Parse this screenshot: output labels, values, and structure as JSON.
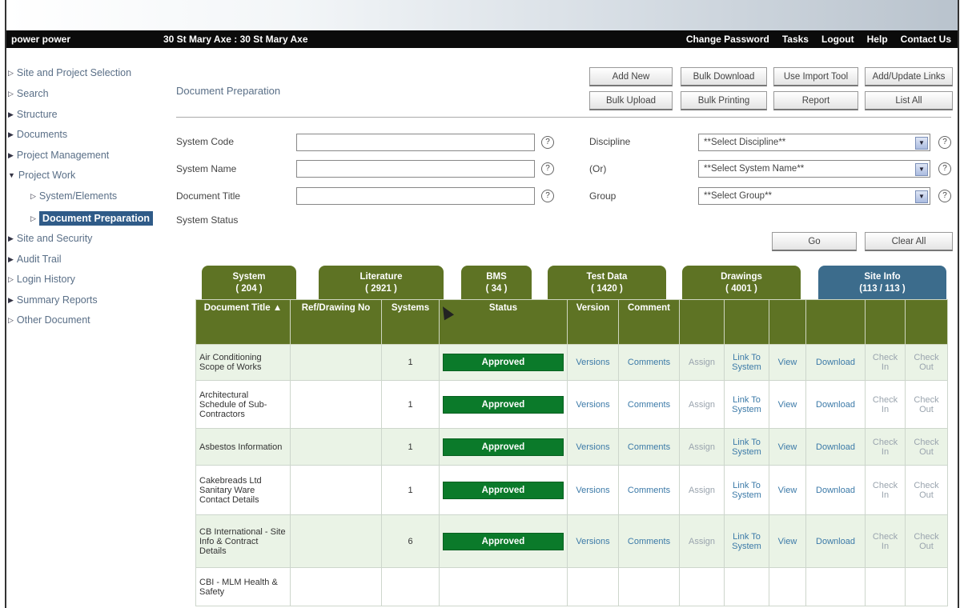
{
  "header": {
    "user": "power power",
    "site": "30 St Mary Axe : 30 St Mary Axe",
    "links": [
      "Change Password",
      "Tasks",
      "Logout",
      "Help",
      "Contact Us"
    ]
  },
  "sidebar": {
    "items": [
      {
        "label": "Site and Project Selection"
      },
      {
        "label": "Search"
      },
      {
        "label": "Structure"
      },
      {
        "label": "Documents"
      },
      {
        "label": "Project Management"
      },
      {
        "label": "Project Work"
      },
      {
        "label": "System/Elements"
      },
      {
        "label": "Document Preparation"
      },
      {
        "label": "Site and Security"
      },
      {
        "label": "Audit Trail"
      },
      {
        "label": "Login History"
      },
      {
        "label": "Summary Reports"
      },
      {
        "label": "Other Document"
      }
    ]
  },
  "page": {
    "title": "Document Preparation"
  },
  "toolbar": {
    "add_new": "Add New",
    "bulk_download": "Bulk Download",
    "use_import_tool": "Use Import Tool",
    "add_update_links": "Add/Update Links",
    "bulk_upload": "Bulk Upload",
    "bulk_printing": "Bulk Printing",
    "report": "Report",
    "list_all": "List All"
  },
  "filters": {
    "system_code": "System Code",
    "system_name": "System Name",
    "document_title": "Document Title",
    "system_status": "System Status",
    "discipline": "Discipline",
    "or": "(Or)",
    "group": "Group",
    "discipline_select": "**Select Discipline**",
    "system_name_select": "**Select System Name**",
    "group_select": "**Select Group**",
    "help": "?",
    "go": "Go",
    "clear_all": "Clear All"
  },
  "tabs": [
    {
      "name": "System",
      "count": "( 204 )"
    },
    {
      "name": "Literature",
      "count": "( 2921 )"
    },
    {
      "name": "BMS",
      "count": "( 34 )"
    },
    {
      "name": "Test Data",
      "count": "( 1420 )"
    },
    {
      "name": "Drawings",
      "count": "( 4001 )"
    },
    {
      "name": "Site Info",
      "count": "(113 / 113 )"
    }
  ],
  "table": {
    "headers": {
      "document_title": "Document Title",
      "sort_indicator": "▲",
      "ref": "Ref/Drawing No",
      "systems": "Systems",
      "status": "Status",
      "version": "Version",
      "comment": "Comment"
    },
    "rows": [
      {
        "title": "Air Conditioning Scope of Works",
        "systems": "1",
        "status": "Approved",
        "versions": "Versions",
        "comments": "Comments",
        "assign": "Assign",
        "link": "Link To System",
        "view": "View",
        "download": "Download",
        "checkin": "Check In",
        "checkout": "Check Out"
      },
      {
        "title": "Architectural Schedule of Sub-Contractors",
        "systems": "1",
        "status": "Approved",
        "versions": "Versions",
        "comments": "Comments",
        "assign": "Assign",
        "link": "Link To System",
        "view": "View",
        "download": "Download",
        "checkin": "Check In",
        "checkout": "Check Out"
      },
      {
        "title": "Asbestos Information",
        "systems": "1",
        "status": "Approved",
        "versions": "Versions",
        "comments": "Comments",
        "assign": "Assign",
        "link": "Link To System",
        "view": "View",
        "download": "Download",
        "checkin": "Check In",
        "checkout": "Check Out"
      },
      {
        "title": "Cakebreads Ltd Sanitary Ware Contact Details",
        "systems": "1",
        "status": "Approved",
        "versions": "Versions",
        "comments": "Comments",
        "assign": "Assign",
        "link": "Link To System",
        "view": "View",
        "download": "Download",
        "checkin": "Check In",
        "checkout": "Check Out"
      },
      {
        "title": "CB International - Site Info & Contract Details",
        "systems": "6",
        "status": "Approved",
        "versions": "Versions",
        "comments": "Comments",
        "assign": "Assign",
        "link": "Link To System",
        "view": "View",
        "download": "Download",
        "checkin": "Check In",
        "checkout": "Check Out"
      },
      {
        "title": "CBI - MLM Health & Safety",
        "systems": "",
        "status": "",
        "versions": "",
        "comments": "",
        "assign": "",
        "link": "",
        "view": "",
        "download": "",
        "checkin": "",
        "checkout": ""
      }
    ]
  }
}
